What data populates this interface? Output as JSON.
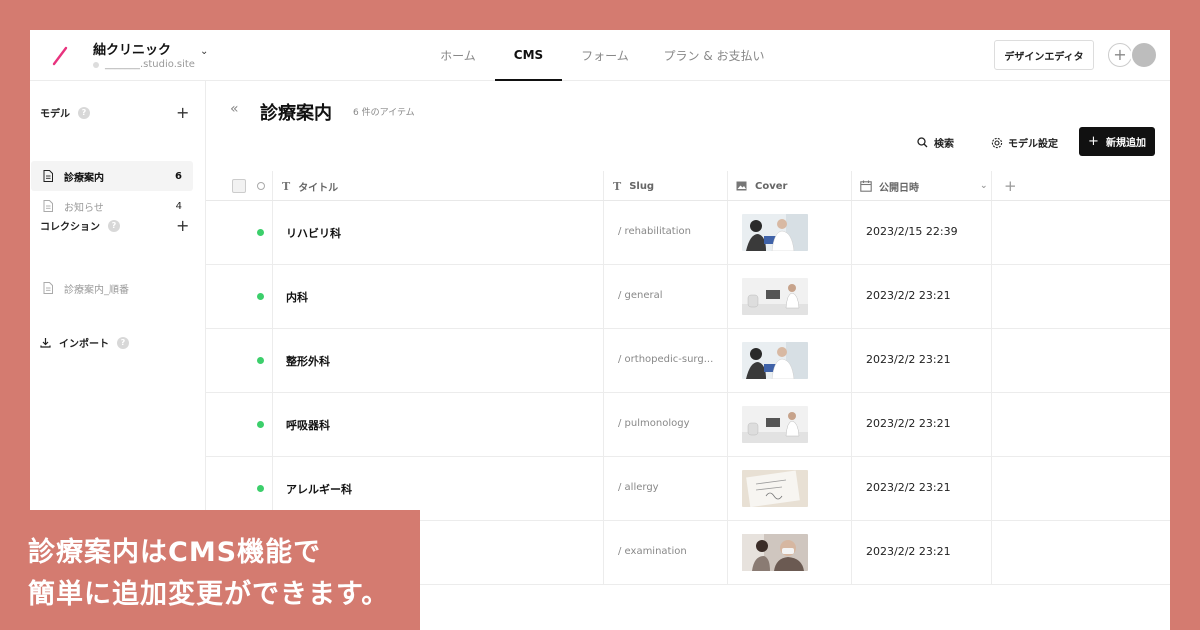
{
  "site": {
    "name": "紬クリニック",
    "url": "_______.studio.site"
  },
  "nav": {
    "tabs": [
      "ホーム",
      "CMS",
      "フォーム",
      "プラン & お支払い"
    ],
    "active": "CMS"
  },
  "header": {
    "design_editor_label": "デザインエディタ"
  },
  "sidebar": {
    "models_label": "モデル",
    "models": [
      {
        "label": "診療案内",
        "count": "6"
      },
      {
        "label": "お知らせ",
        "count": "4"
      }
    ],
    "collections_label": "コレクション",
    "collections": [
      {
        "label": "診療案内_順番"
      }
    ],
    "import_label": "インポート"
  },
  "main": {
    "title": "診療案内",
    "item_count": "6 件のアイテム",
    "search_label": "検索",
    "model_settings_label": "モデル設定",
    "new_label": "新規追加"
  },
  "table": {
    "columns": [
      "タイトル",
      "Slug",
      "Cover",
      "公開日時"
    ],
    "rows": [
      {
        "title": "リハビリ科",
        "slug": "/ rehabilitation",
        "date": "2023/2/15 22:39",
        "cover": "doctor-consult"
      },
      {
        "title": "内科",
        "slug": "/ general",
        "date": "2023/2/2 23:21",
        "cover": "clinic-room"
      },
      {
        "title": "整形外科",
        "slug": "/ orthopedic-surg...",
        "date": "2023/2/2 23:21",
        "cover": "doctor-consult"
      },
      {
        "title": "呼吸器科",
        "slug": "/ pulmonology",
        "date": "2023/2/2 23:21",
        "cover": "clinic-room"
      },
      {
        "title": "アレルギー科",
        "slug": "/ allergy",
        "date": "2023/2/2 23:21",
        "cover": "medical-chart"
      },
      {
        "title": "",
        "slug": "/ examination",
        "date": "2023/2/2 23:21",
        "cover": "patient-exam"
      }
    ]
  },
  "caption": {
    "line1": "診療案内はCMS機能で",
    "line2": "簡単に追加変更ができます。"
  },
  "colors": {
    "background": "#d47b70",
    "status_green": "#3ccf6b",
    "brand_pink": "#e8337e"
  }
}
